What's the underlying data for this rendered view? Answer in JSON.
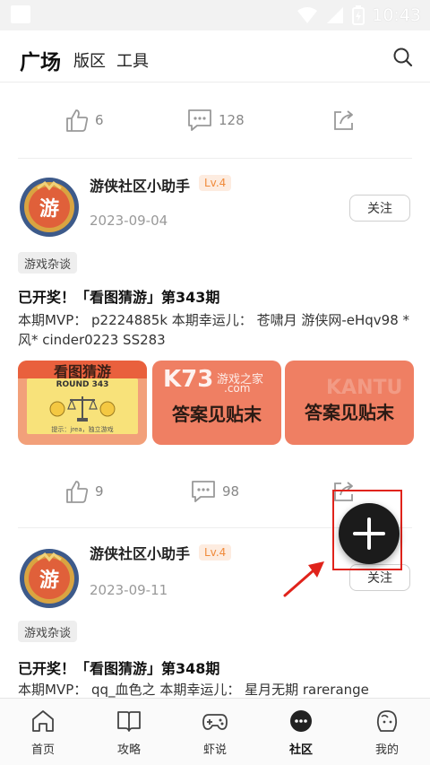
{
  "status_bar": {
    "time": "10:43"
  },
  "header": {
    "tabs": [
      {
        "label": "广场",
        "active": true
      },
      {
        "label": "版区",
        "active": false
      },
      {
        "label": "工具",
        "active": false
      }
    ]
  },
  "top_actions": {
    "likes": "6",
    "comments": "128"
  },
  "posts": [
    {
      "author": "游侠社区小助手",
      "level": "Lv.4",
      "date": "2023-09-04",
      "follow_label": "关注",
      "tag": "游戏杂谈",
      "title": "已开奖！「看图猜游」第343期",
      "body": "本期MVP： p2224885k 本期幸运儿： 苍啸月 游侠网-eHqv98 *风* cinder0223 SS283",
      "images": [
        {
          "heading": "看图猜游",
          "round": "ROUND 343",
          "footer": "提示：jrea，独立游戏"
        },
        {
          "text": "答案见贴末",
          "watermark_site": "游戏之家",
          "watermark_domain": ".com",
          "watermark_brand": "K73"
        },
        {
          "text": "答案见贴末",
          "watermark_bg": "KANTU"
        }
      ],
      "likes": "9",
      "comments": "98"
    },
    {
      "author": "游侠社区小助手",
      "level": "Lv.4",
      "date": "2023-09-11",
      "follow_label": "关注",
      "tag": "游戏杂谈",
      "title": "已开奖！「看图猜游」第348期",
      "body": "本期MVP： qq_血色之 本期幸运儿： 星月无期 rarerange"
    }
  ],
  "bottom_nav": [
    {
      "label": "首页",
      "icon": "home-icon",
      "active": false
    },
    {
      "label": "攻略",
      "icon": "book-icon",
      "active": false
    },
    {
      "label": "虾说",
      "icon": "gamepad-icon",
      "active": false
    },
    {
      "label": "社区",
      "icon": "community-icon",
      "active": true
    },
    {
      "label": "我的",
      "icon": "profile-icon",
      "active": false
    }
  ],
  "colors": {
    "accent_orange": "#f08a3a",
    "highlight_red": "#e0231b",
    "fab_dark": "#1b1b1b"
  }
}
